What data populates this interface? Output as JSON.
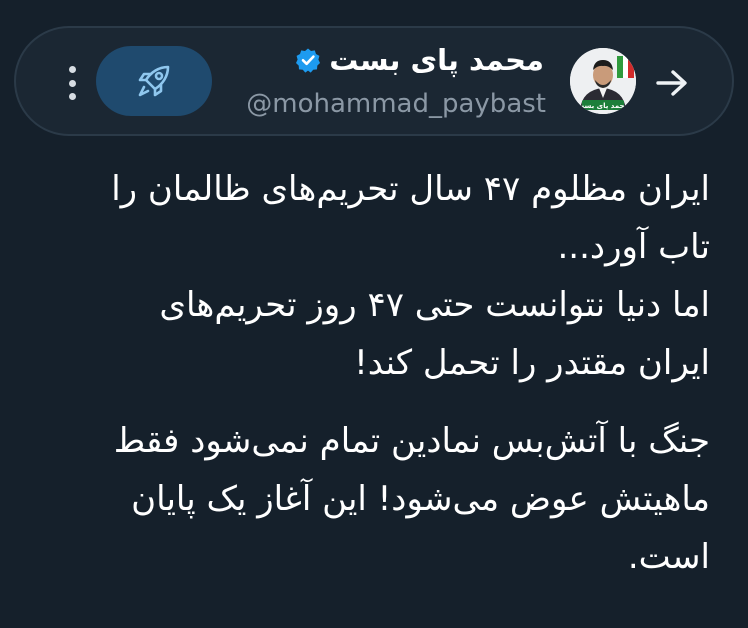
{
  "header": {
    "display_name": "محمد پای بست",
    "handle": "@mohammad_paybast",
    "verified": true,
    "icons": {
      "back": "arrow-right-icon",
      "verified": "verified-badge-icon",
      "boost": "rocket-icon",
      "more": "more-vertical-icon"
    },
    "colors": {
      "verified": "#1d9bf0",
      "boost_bg": "#1f4a6e",
      "accent": "#8fc7ee"
    }
  },
  "avatar": {
    "caption": "محمد پای بست"
  },
  "tweet": {
    "paragraphs": [
      {
        "lines": [
          "ایران مظلوم ۴۷ سال تحریم‌های ظالمان را",
          "تاب آورد...",
          "اما دنیا نتوانست حتی ۴۷ روز تحریم‌های",
          "ایران مقتدر را تحمل کند!"
        ]
      },
      {
        "lines": [
          "جنگ با آتش‌بس نمادین تمام نمی‌شود فقط",
          "ماهیتش عوض می‌شود! این آغاز یک پایان",
          "است."
        ]
      }
    ]
  },
  "theme": {
    "background": "#15202b",
    "text": "#ffffff",
    "muted": "#8b98a5"
  }
}
